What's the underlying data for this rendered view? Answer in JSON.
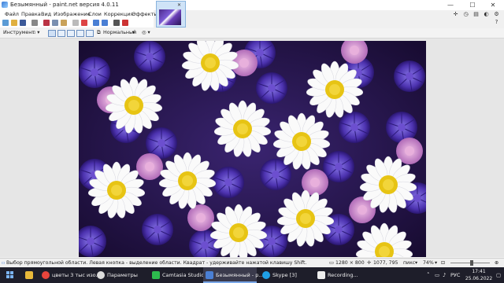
{
  "window": {
    "title": "Безымянный - paint.net версия 4.0.11",
    "minimize": "—",
    "maximize": "☐",
    "close": "✕"
  },
  "menu": {
    "items": [
      "Файл",
      "Правка",
      "Вид",
      "Изображение",
      "Слои",
      "Коррекция",
      "Эффекты"
    ]
  },
  "toolbar2": {
    "tool_label": "Инструмент",
    "blend_mode": "Нормальный"
  },
  "status": {
    "hint": "Выбор прямоугольной области. Левая кнопка - выделение области. Квадрат - удерживайте нажатой клавишу Shift.",
    "image_size": "1280 × 800",
    "cursor_pos": "1077, 795",
    "units": "пикс",
    "zoom": "74%"
  },
  "taskbar": {
    "items": [
      {
        "label": "цветы 3 тыс изо...",
        "icon_color": "#e8453c",
        "active": false
      },
      {
        "label": "Параметры",
        "icon_color": "#dcdcdc",
        "active": false
      },
      {
        "label": "Camtasia Studio ...",
        "icon_color": "#2dbb4e",
        "active": false
      },
      {
        "label": "Безымянный - p...",
        "icon_color": "#4a7fd4",
        "active": true
      },
      {
        "label": "Skype [3]",
        "icon_color": "#1fa0e6",
        "active": false
      },
      {
        "label": "Recording...",
        "icon_color": "#eeeeee",
        "active": false
      }
    ],
    "lang": "РУС",
    "time": "17:41",
    "date": "25.06.2022"
  },
  "colors": {
    "accent": "#4a7fd4",
    "taskbar_bg": "#1e1e2a"
  }
}
